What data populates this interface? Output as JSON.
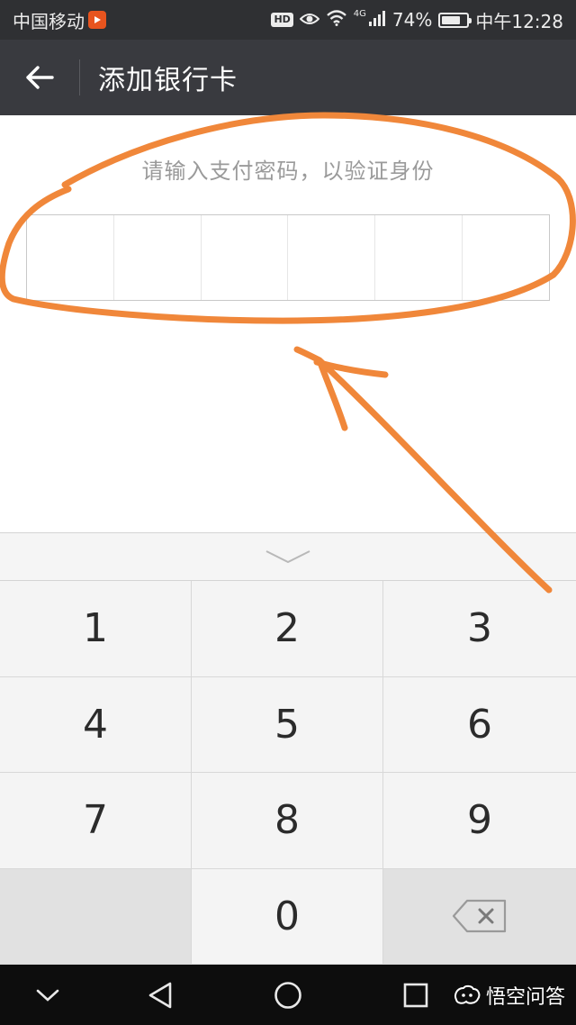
{
  "status_bar": {
    "carrier": "中国移动",
    "network": "4G",
    "battery_percent": "74%",
    "battery_level": 0.74,
    "time": "中午12:28",
    "hd_label": "HD"
  },
  "app_bar": {
    "title": "添加银行卡",
    "back_icon": "arrow-left-icon"
  },
  "password_prompt": "请输入支付密码，以验证身份",
  "pin_length": 6,
  "keypad": {
    "collapse_icon": "chevron-down-icon",
    "keys": [
      "1",
      "2",
      "3",
      "4",
      "5",
      "6",
      "7",
      "8",
      "9",
      "",
      "0",
      "delete"
    ]
  },
  "nav_bar": {
    "icons": [
      "chevron-down-icon",
      "back-triangle-icon",
      "home-circle-icon",
      "recents-square-icon"
    ]
  },
  "watermark": "悟空问答",
  "colors": {
    "status_bar": "#2f3033",
    "app_bar": "#393a3f",
    "annotation": "#f0873a",
    "prompt_text": "#9a9a9a"
  }
}
